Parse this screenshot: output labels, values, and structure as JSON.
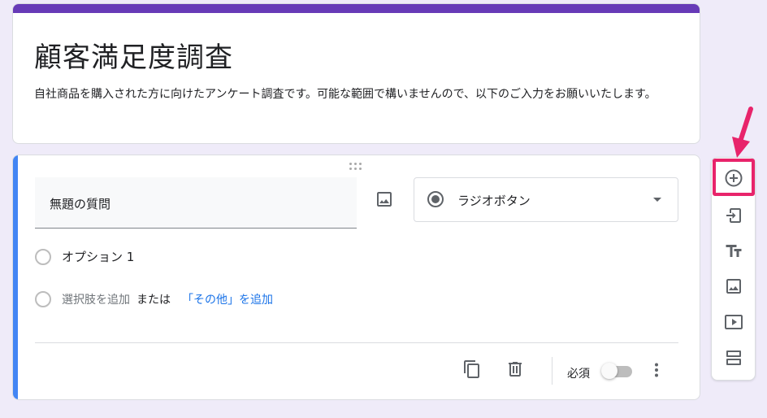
{
  "form": {
    "title": "顧客満足度調査",
    "description": "自社商品を購入された方に向けたアンケート調査です。可能な範囲で構いませんので、以下のご入力をお願いいたします。",
    "accent_color": "#673ab7"
  },
  "question": {
    "title_placeholder": "無題の質問",
    "type_label": "ラジオボタン",
    "options": [
      {
        "label": "オプション 1"
      }
    ],
    "add_option_label": "選択肢を追加",
    "or_label": "または",
    "add_other_label": "「その他」を追加",
    "required_label": "必須",
    "required": false,
    "accent_color": "#4285f4"
  },
  "toolbar": {
    "items": [
      {
        "name": "add-question",
        "icon": "add-circle-icon"
      },
      {
        "name": "import-questions",
        "icon": "import-icon"
      },
      {
        "name": "add-title",
        "icon": "title-text-icon"
      },
      {
        "name": "add-image",
        "icon": "image-icon"
      },
      {
        "name": "add-video",
        "icon": "video-icon"
      },
      {
        "name": "add-section",
        "icon": "section-icon"
      }
    ]
  },
  "annotation": {
    "highlight_color": "#e8246b"
  }
}
